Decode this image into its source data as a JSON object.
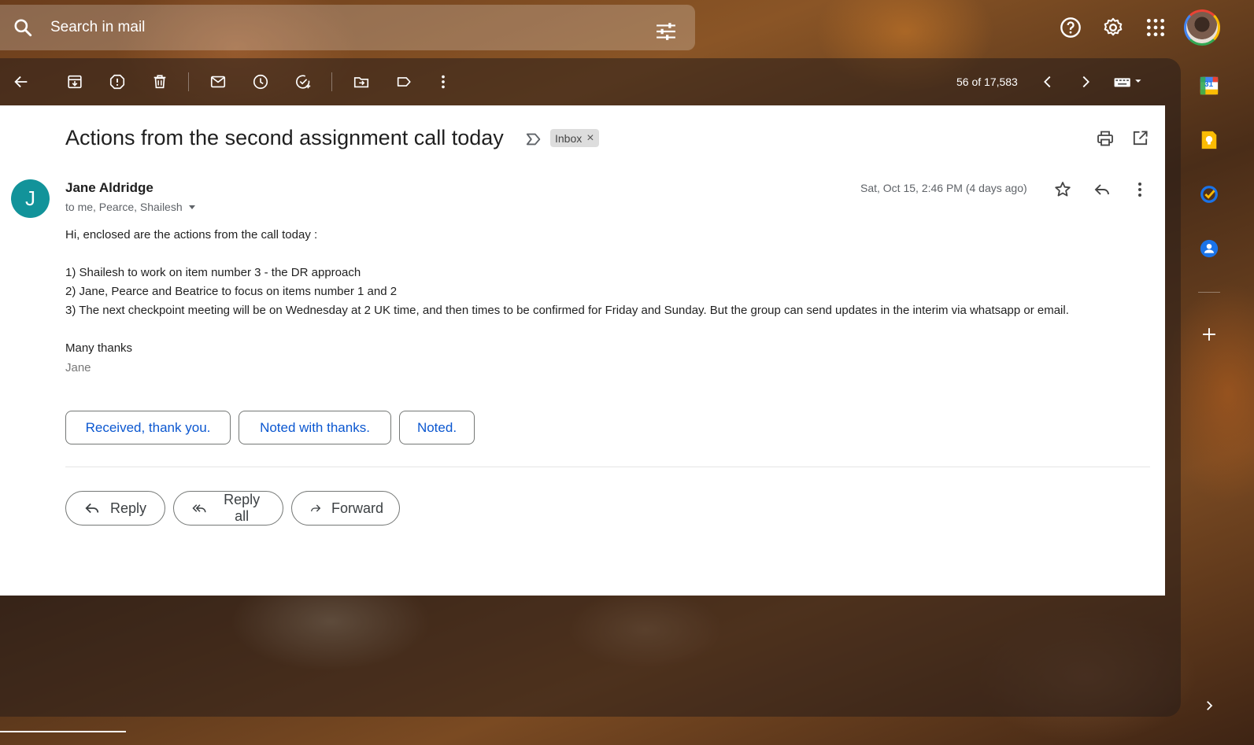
{
  "search": {
    "placeholder": "Search in mail"
  },
  "toolbar": {
    "counter": "56 of 17,583"
  },
  "email": {
    "subject": "Actions from the second assignment call today",
    "label": "Inbox",
    "label_close": "×",
    "sender_initial": "J",
    "sender_name": "Jane Aldridge",
    "recipients": "to me, Pearce, Shailesh",
    "date": "Sat, Oct 15, 2:46 PM (4 days ago)",
    "body": [
      "Hi, enclosed are the actions from the call today :",
      "1) Shailesh to work on item number 3 - the DR approach",
      "2) Jane, Pearce and Beatrice to focus on items number 1 and 2",
      "3) The next checkpoint meeting will be on Wednesday at 2 UK time, and then times to be confirmed for Friday and Sunday. But the group can send updates in the interim via whatsapp or email.",
      "Many thanks"
    ],
    "signature": "Jane"
  },
  "smart_replies": [
    "Received, thank you.",
    "Noted with thanks.",
    "Noted."
  ],
  "actions": {
    "reply": "Reply",
    "reply_all": "Reply all",
    "forward": "Forward"
  },
  "side_panel": {
    "calendar_day": "31"
  },
  "colors": {
    "accent": "#0b57d0",
    "avatar": "#12939a"
  }
}
